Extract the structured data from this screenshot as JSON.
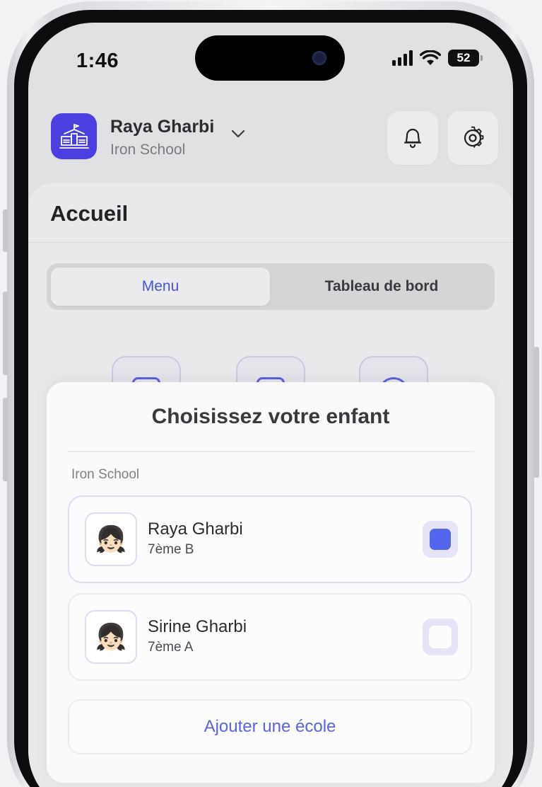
{
  "status_bar": {
    "time": "1:46",
    "battery": "52",
    "icons": [
      "signal-icon",
      "wifi-icon",
      "battery-icon"
    ]
  },
  "header": {
    "user_name": "Raya Gharbi",
    "school_name": "Iron School",
    "buttons": [
      "bell-icon",
      "gear-icon"
    ]
  },
  "page": {
    "title": "Accueil",
    "tabs": [
      {
        "label": "Menu",
        "active": true
      },
      {
        "label": "Tableau de bord",
        "active": false
      }
    ]
  },
  "sheet": {
    "title": "Choisissez votre enfant",
    "section_label": "Iron School",
    "children": [
      {
        "name": "Raya Gharbi",
        "class": "7ème B",
        "avatar": "👧🏻",
        "selected": true
      },
      {
        "name": "Sirine Gharbi",
        "class": "7ème A",
        "avatar": "👧🏻",
        "selected": false
      }
    ],
    "add_school_label": "Ajouter une école"
  },
  "colors": {
    "accent": "#5566ee",
    "brand": "#4b3fe0"
  }
}
